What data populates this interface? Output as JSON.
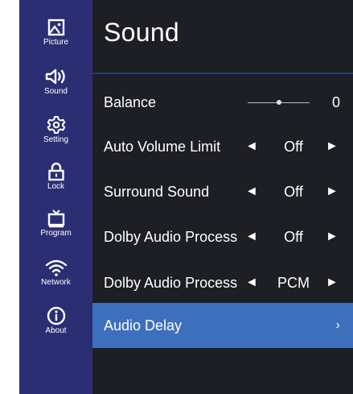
{
  "sidebar": {
    "items": [
      {
        "label": "Picture",
        "icon": "picture-icon"
      },
      {
        "label": "Sound",
        "icon": "speaker-icon"
      },
      {
        "label": "Setting",
        "icon": "gear-icon"
      },
      {
        "label": "Lock",
        "icon": "lock-icon"
      },
      {
        "label": "Program",
        "icon": "tv-icon"
      },
      {
        "label": "Network",
        "icon": "wifi-icon"
      },
      {
        "label": "About",
        "icon": "info-icon"
      }
    ]
  },
  "main": {
    "title": "Sound",
    "balance": {
      "label": "Balance",
      "value": "0",
      "level": 0.5
    },
    "rows": [
      {
        "label": "Auto Volume Limit",
        "left": "◄",
        "value": "Off",
        "right": "►"
      },
      {
        "label": "Surround Sound",
        "left": "◄",
        "value": "Off",
        "right": "►"
      },
      {
        "label": "Dolby Audio Process",
        "left": "◄",
        "value": "Off",
        "right": "►"
      },
      {
        "label": "Dolby Audio Process",
        "left": "◄",
        "value": "PCM",
        "right": "►"
      }
    ],
    "audio_delay": {
      "label": "Audio Delay",
      "chevron": "›"
    }
  },
  "colors": {
    "sidebar_bg": "#2c2e74",
    "content_bg": "#1d1f24",
    "selected_bg": "#3d6fbd",
    "divider": "#1e3f7a"
  }
}
